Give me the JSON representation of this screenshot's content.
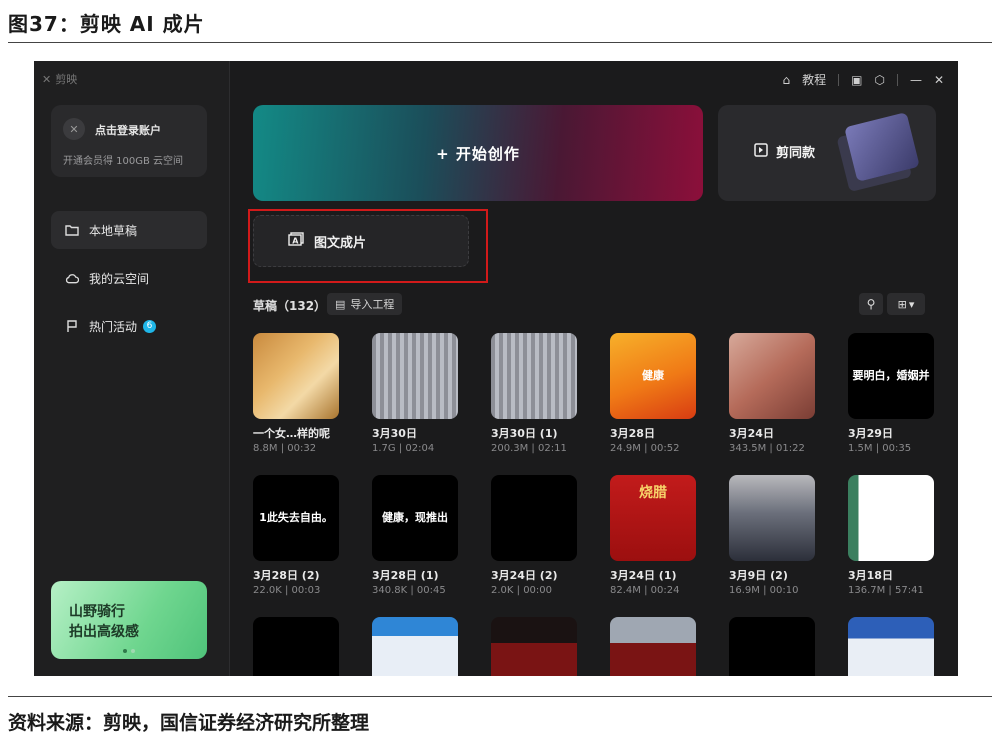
{
  "doc": {
    "figure_title": "图37：剪映 AI 成片",
    "source": "资料来源：剪映，国信证券经济研究所整理"
  },
  "app": {
    "logo_text": "剪映",
    "login": {
      "title": "点击登录账户",
      "subtitle": "开通会员得 100GB 云空间"
    },
    "nav": [
      {
        "label": "本地草稿",
        "icon": "folder-icon",
        "active": true
      },
      {
        "label": "我的云空间",
        "icon": "cloud-icon",
        "active": false
      },
      {
        "label": "热门活动",
        "icon": "flag-icon",
        "active": false,
        "badge": "6"
      }
    ],
    "promo": {
      "line1": "山野骑行",
      "line2": "拍出高级感"
    },
    "topbar": {
      "tutorial_label": "教程"
    },
    "hero": {
      "create_label": "开始创作",
      "template_label": "剪同款"
    },
    "graphic": {
      "label": "图文成片"
    },
    "drafts": {
      "title": "草稿（132）",
      "import_label": "导入工程"
    },
    "draft_items": [
      {
        "name": "一个女…样的呢",
        "meta": "8.8M | 00:32",
        "overlay": ""
      },
      {
        "name": "3月30日",
        "meta": "1.7G | 02:04",
        "overlay": ""
      },
      {
        "name": "3月30日 (1)",
        "meta": "200.3M | 02:11",
        "overlay": ""
      },
      {
        "name": "3月28日",
        "meta": "24.9M | 00:52",
        "overlay": "健康"
      },
      {
        "name": "3月24日",
        "meta": "343.5M | 01:22",
        "overlay": ""
      },
      {
        "name": "3月29日",
        "meta": "1.5M | 00:35",
        "overlay": "要明白，婚姻并"
      },
      {
        "name": "",
        "meta": "",
        "overlay": "1此失去自由。"
      },
      {
        "name": "3月28日 (2)",
        "meta": "22.0K | 00:03",
        "overlay": ""
      },
      {
        "name": "3月28日 (1)",
        "meta": "340.8K | 00:45",
        "overlay": "健康，现推出"
      },
      {
        "name": "3月24日 (2)",
        "meta": "2.0K | 00:00",
        "overlay": ""
      },
      {
        "name": "3月24日 (1)",
        "meta": "82.4M | 00:24",
        "overlay": "烧腊"
      },
      {
        "name": "3月9日 (2)",
        "meta": "16.9M | 00:10",
        "overlay": ""
      },
      {
        "name": "3月18日",
        "meta": "136.7M | 57:41",
        "overlay": ""
      }
    ]
  }
}
